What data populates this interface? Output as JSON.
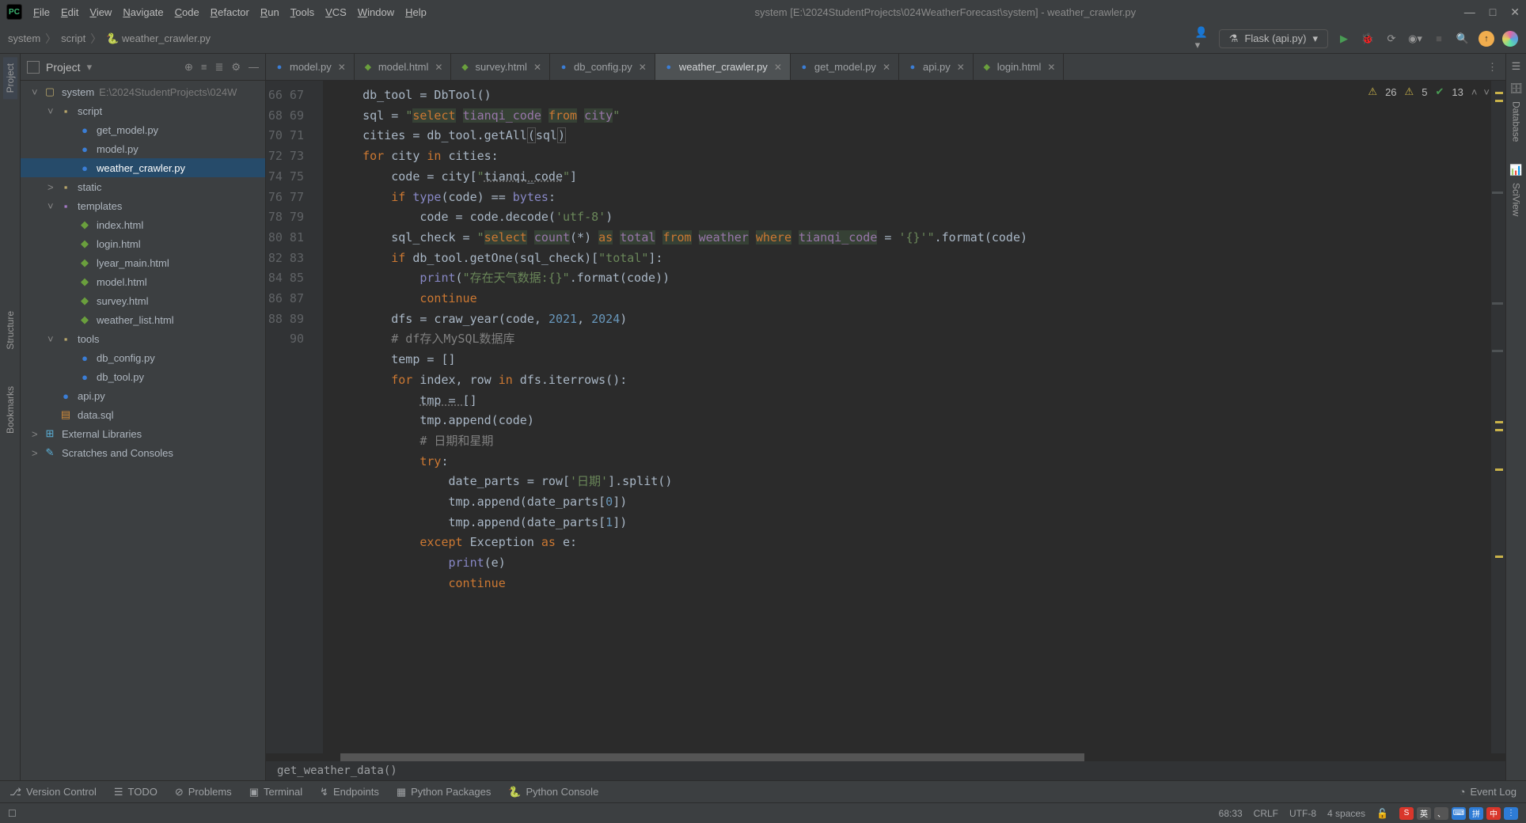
{
  "window": {
    "title": "system [E:\\2024StudentProjects\\024WeatherForecast\\system] - weather_crawler.py"
  },
  "menu": [
    "File",
    "Edit",
    "View",
    "Navigate",
    "Code",
    "Refactor",
    "Run",
    "Tools",
    "VCS",
    "Window",
    "Help"
  ],
  "breadcrumbs": [
    "system",
    "script",
    "weather_crawler.py"
  ],
  "runconfig": "Flask (api.py)",
  "project_panel_title": "Project",
  "left_tabs": [
    "Project",
    "Structure",
    "Bookmarks"
  ],
  "right_tabs": [
    "Database",
    "SciView"
  ],
  "tree": [
    {
      "depth": 0,
      "expand": "open",
      "type": "project",
      "label": "system",
      "suffix": " E:\\2024StudentProjects\\024W"
    },
    {
      "depth": 1,
      "expand": "open",
      "type": "folder",
      "label": "script"
    },
    {
      "depth": 2,
      "type": "py",
      "label": "get_model.py"
    },
    {
      "depth": 2,
      "type": "py",
      "label": "model.py"
    },
    {
      "depth": 2,
      "type": "py",
      "label": "weather_crawler.py",
      "selected": true
    },
    {
      "depth": 1,
      "expand": "closed",
      "type": "folder",
      "label": "static"
    },
    {
      "depth": 1,
      "expand": "open",
      "type": "folder-pkg",
      "label": "templates"
    },
    {
      "depth": 2,
      "type": "html",
      "label": "index.html"
    },
    {
      "depth": 2,
      "type": "html",
      "label": "login.html"
    },
    {
      "depth": 2,
      "type": "html",
      "label": "lyear_main.html"
    },
    {
      "depth": 2,
      "type": "html",
      "label": "model.html"
    },
    {
      "depth": 2,
      "type": "html",
      "label": "survey.html"
    },
    {
      "depth": 2,
      "type": "html",
      "label": "weather_list.html"
    },
    {
      "depth": 1,
      "expand": "open",
      "type": "folder",
      "label": "tools"
    },
    {
      "depth": 2,
      "type": "py",
      "label": "db_config.py"
    },
    {
      "depth": 2,
      "type": "py",
      "label": "db_tool.py"
    },
    {
      "depth": 1,
      "type": "py",
      "label": "api.py"
    },
    {
      "depth": 1,
      "type": "sql",
      "label": "data.sql"
    },
    {
      "depth": 0,
      "expand": "closed",
      "type": "lib",
      "label": "External Libraries"
    },
    {
      "depth": 0,
      "expand": "closed",
      "type": "scratch",
      "label": "Scratches and Consoles"
    }
  ],
  "tabs": [
    {
      "label": "model.py",
      "type": "py"
    },
    {
      "label": "model.html",
      "type": "html"
    },
    {
      "label": "survey.html",
      "type": "html"
    },
    {
      "label": "db_config.py",
      "type": "py"
    },
    {
      "label": "weather_crawler.py",
      "type": "py",
      "active": true
    },
    {
      "label": "get_model.py",
      "type": "py"
    },
    {
      "label": "api.py",
      "type": "py"
    },
    {
      "label": "login.html",
      "type": "html"
    }
  ],
  "insights": {
    "warn1": "26",
    "warn2": "5",
    "ok": "13"
  },
  "code_start_line": 66,
  "code_lines": [
    "    db_tool = DbTool()",
    "    sql = <q>\"</q><sql>select</sql> <sqli>tianqi_code</sqli> <sql>from</sql> <sqli>city</sqli><q>\"</q>",
    "    cities = db_tool.getAll<hl>(</hl>sql<hl>)</hl>",
    "    <k>for</k> city <k>in</k> cities:",
    "        code = city[<s>\"</s><u>tianqi_code</u><s>\"</s>]",
    "        <k>if</k> <b>type</b>(code) == <b>bytes</b>:",
    "            code = code.decode(<s>'utf-8'</s>)",
    "        sql_check = <q>\"</q><sql>select</sql> <sqli>count</sqli>(*) <sql>as</sql> <sqli>total</sqli> <sql>from</sql> <sqli>weather</sqli> <sql>where</sql> <sqli>tianqi_code</sqli> = <s>'{}'</s><q>\"</q>.format(code)",
    "        <k>if</k> db_tool.getOne(sql_check)[<s>\"total\"</s>]:",
    "            <b>print</b>(<s>\"存在天气数据:{}\"</s>.format(code))",
    "            <k>continue</k>",
    "        dfs = craw_year(code, <n>2021</n>, <n>2024</n>)",
    "        <c># df存入MySQL数据库</c>",
    "        temp = []",
    "        <k>for</k> index, row <k>in</k> dfs.iterrows():",
    "            <u>tmp = []</u>",
    "            tmp.append(code)",
    "            <c># 日期和星期</c>",
    "            <k>try</k>:",
    "                date_parts = row[<s>'日期'</s>].split()",
    "                tmp.append(date_parts[<n>0</n>])",
    "                tmp.append(date_parts[<n>1</n>])",
    "            <k>except</k> Exception <k>as</k> e:",
    "                <b>print</b>(e)",
    "                <k>continue</k>"
  ],
  "editor_breadcrumb": "get_weather_data()",
  "tool_windows": [
    "Version Control",
    "TODO",
    "Problems",
    "Terminal",
    "Endpoints",
    "Python Packages",
    "Python Console"
  ],
  "event_log": "Event Log",
  "status": {
    "pos": "68:33",
    "eol": "CRLF",
    "enc": "UTF-8",
    "indent": "4 spaces"
  },
  "ime": [
    "S",
    "英",
    "、",
    "⌨",
    "拼",
    "中",
    "⋮"
  ]
}
